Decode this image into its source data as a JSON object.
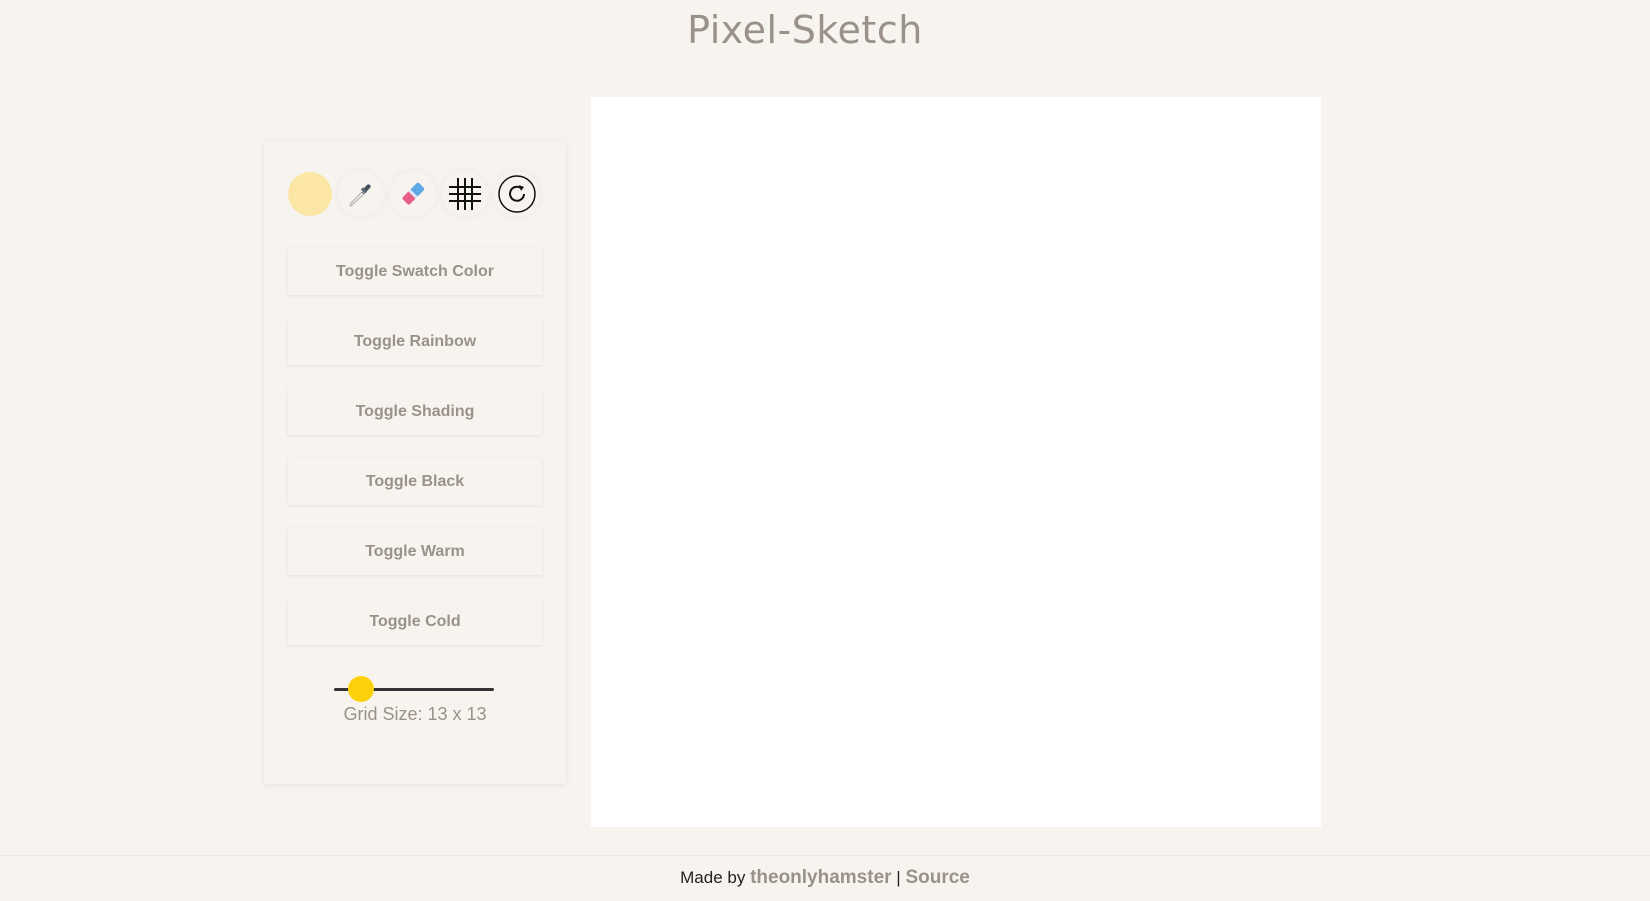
{
  "title": "Pixel-Sketch",
  "tools": {
    "swatch_color": "#fbe6a6",
    "picker_icon": "eyedropper-icon",
    "eraser_icon": "eraser-icon",
    "grid_icon": "grid-icon",
    "reset_icon": "reset-icon"
  },
  "buttons": [
    {
      "label": "Toggle Swatch Color"
    },
    {
      "label": "Toggle Rainbow"
    },
    {
      "label": "Toggle Shading"
    },
    {
      "label": "Toggle Black"
    },
    {
      "label": "Toggle Warm"
    },
    {
      "label": "Toggle Cold"
    }
  ],
  "slider": {
    "value_fraction": 0.17,
    "thumb_color": "#fcd10c"
  },
  "grid_size_label": "Grid Size: 13 x 13",
  "footer": {
    "prefix": "Made by",
    "author": "theonlyhamster",
    "separator": "|",
    "source": "Source"
  }
}
